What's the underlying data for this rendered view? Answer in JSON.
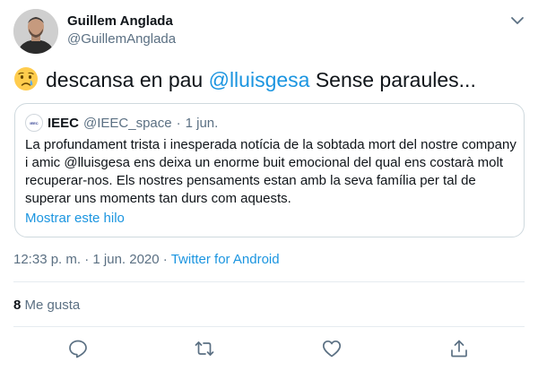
{
  "author": {
    "name": "Guillem Anglada",
    "handle": "@GuillemAnglada"
  },
  "tweet": {
    "emoji": "crying-face-icon",
    "text_before": "descansa en pau ",
    "mention": "@lluisgesa",
    "text_after": " Sense paraules..."
  },
  "quote": {
    "avatar_text": "IEEC",
    "name": "IEEC",
    "handle": "@IEEC_space",
    "separator": "·",
    "date": "1 jun.",
    "body": "La profundament trista i inesperada notícia de la sobtada mort del nostre company i amic @lluisgesa ens deixa un enorme buit emocional del qual ens costarà molt recuperar-nos. Els nostres pensaments estan amb la seva família per tal de superar uns moments tan durs com aquests.",
    "show_thread": "Mostrar este hilo"
  },
  "meta": {
    "time": "12:33 p. m.",
    "separator1": "·",
    "date": "1 jun. 2020",
    "separator2": "·",
    "source": "Twitter for Android"
  },
  "likes": {
    "count": "8",
    "label": "Me gusta"
  },
  "actions": [
    "reply-icon",
    "retweet-icon",
    "like-icon",
    "share-icon"
  ],
  "colors": {
    "link": "#1b95e0",
    "secondary_text": "#5b7083",
    "border": "#cfd9de"
  }
}
